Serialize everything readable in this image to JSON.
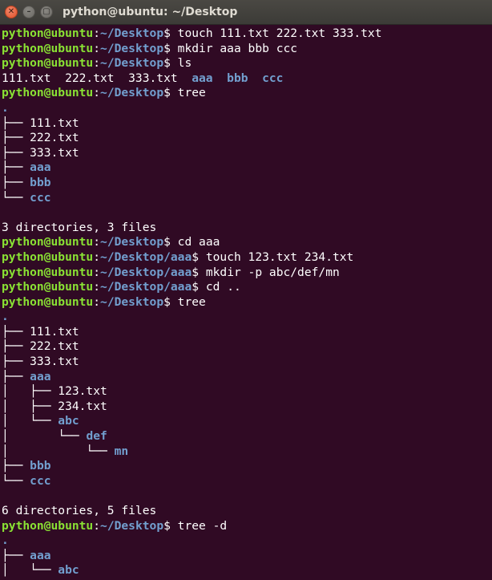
{
  "window": {
    "title": "python@ubuntu: ~/Desktop",
    "close_glyph": "✕",
    "min_glyph": "–",
    "max_glyph": "▢"
  },
  "terminal": {
    "lines": [
      [
        {
          "t": "python@ubuntu",
          "c": "user"
        },
        {
          "t": ":"
        },
        {
          "t": "~/Desktop",
          "c": "path"
        },
        {
          "t": "$ touch 111.txt 222.txt 333.txt"
        }
      ],
      [
        {
          "t": "python@ubuntu",
          "c": "user"
        },
        {
          "t": ":"
        },
        {
          "t": "~/Desktop",
          "c": "path"
        },
        {
          "t": "$ mkdir aaa bbb ccc"
        }
      ],
      [
        {
          "t": "python@ubuntu",
          "c": "user"
        },
        {
          "t": ":"
        },
        {
          "t": "~/Desktop",
          "c": "path"
        },
        {
          "t": "$ ls"
        }
      ],
      [
        {
          "t": "111.txt  222.txt  333.txt  "
        },
        {
          "t": "aaa",
          "c": "dir"
        },
        {
          "t": "  "
        },
        {
          "t": "bbb",
          "c": "dir"
        },
        {
          "t": "  "
        },
        {
          "t": "ccc",
          "c": "dir"
        }
      ],
      [
        {
          "t": "python@ubuntu",
          "c": "user"
        },
        {
          "t": ":"
        },
        {
          "t": "~/Desktop",
          "c": "path"
        },
        {
          "t": "$ tree"
        }
      ],
      [
        {
          "t": ".",
          "c": "dir"
        }
      ],
      [
        {
          "t": "├── 111.txt"
        }
      ],
      [
        {
          "t": "├── 222.txt"
        }
      ],
      [
        {
          "t": "├── 333.txt"
        }
      ],
      [
        {
          "t": "├── "
        },
        {
          "t": "aaa",
          "c": "dir"
        }
      ],
      [
        {
          "t": "├── "
        },
        {
          "t": "bbb",
          "c": "dir"
        }
      ],
      [
        {
          "t": "└── "
        },
        {
          "t": "ccc",
          "c": "dir"
        }
      ],
      [
        {
          "t": ""
        }
      ],
      [
        {
          "t": "3 directories, 3 files"
        }
      ],
      [
        {
          "t": "python@ubuntu",
          "c": "user"
        },
        {
          "t": ":"
        },
        {
          "t": "~/Desktop",
          "c": "path"
        },
        {
          "t": "$ cd aaa"
        }
      ],
      [
        {
          "t": "python@ubuntu",
          "c": "user"
        },
        {
          "t": ":"
        },
        {
          "t": "~/Desktop/aaa",
          "c": "path"
        },
        {
          "t": "$ touch 123.txt 234.txt"
        }
      ],
      [
        {
          "t": "python@ubuntu",
          "c": "user"
        },
        {
          "t": ":"
        },
        {
          "t": "~/Desktop/aaa",
          "c": "path"
        },
        {
          "t": "$ mkdir -p abc/def/mn"
        }
      ],
      [
        {
          "t": "python@ubuntu",
          "c": "user"
        },
        {
          "t": ":"
        },
        {
          "t": "~/Desktop/aaa",
          "c": "path"
        },
        {
          "t": "$ cd .."
        }
      ],
      [
        {
          "t": "python@ubuntu",
          "c": "user"
        },
        {
          "t": ":"
        },
        {
          "t": "~/Desktop",
          "c": "path"
        },
        {
          "t": "$ tree"
        }
      ],
      [
        {
          "t": ".",
          "c": "dir"
        }
      ],
      [
        {
          "t": "├── 111.txt"
        }
      ],
      [
        {
          "t": "├── 222.txt"
        }
      ],
      [
        {
          "t": "├── 333.txt"
        }
      ],
      [
        {
          "t": "├── "
        },
        {
          "t": "aaa",
          "c": "dir"
        }
      ],
      [
        {
          "t": "│   ├── 123.txt"
        }
      ],
      [
        {
          "t": "│   ├── 234.txt"
        }
      ],
      [
        {
          "t": "│   └── "
        },
        {
          "t": "abc",
          "c": "dir"
        }
      ],
      [
        {
          "t": "│       └── "
        },
        {
          "t": "def",
          "c": "dir"
        }
      ],
      [
        {
          "t": "│           └── "
        },
        {
          "t": "mn",
          "c": "dir"
        }
      ],
      [
        {
          "t": "├── "
        },
        {
          "t": "bbb",
          "c": "dir"
        }
      ],
      [
        {
          "t": "└── "
        },
        {
          "t": "ccc",
          "c": "dir"
        }
      ],
      [
        {
          "t": ""
        }
      ],
      [
        {
          "t": "6 directories, 5 files"
        }
      ],
      [
        {
          "t": "python@ubuntu",
          "c": "user"
        },
        {
          "t": ":"
        },
        {
          "t": "~/Desktop",
          "c": "path"
        },
        {
          "t": "$ tree -d"
        }
      ],
      [
        {
          "t": ".",
          "c": "dir"
        }
      ],
      [
        {
          "t": "├── "
        },
        {
          "t": "aaa",
          "c": "dir"
        }
      ],
      [
        {
          "t": "│   └── "
        },
        {
          "t": "abc",
          "c": "dir"
        }
      ]
    ]
  },
  "colors": {
    "background": "#300a24",
    "prompt_user": "#8ae234",
    "prompt_path": "#729fcf",
    "directory": "#729fcf",
    "text": "#ffffff"
  }
}
